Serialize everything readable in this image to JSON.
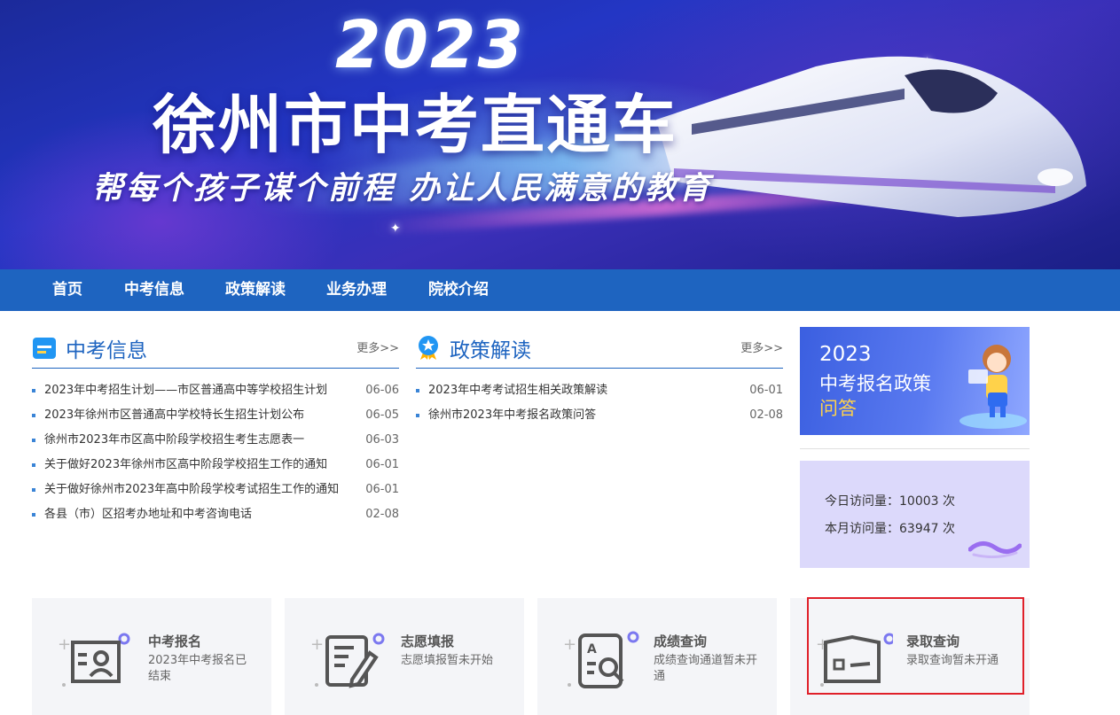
{
  "banner": {
    "year": "2023",
    "title": "徐州市中考直通车",
    "slogan": "帮每个孩子谋个前程  办让人民满意的教育"
  },
  "nav": {
    "items": [
      {
        "label": "首页"
      },
      {
        "label": "中考信息"
      },
      {
        "label": "政策解读"
      },
      {
        "label": "业务办理"
      },
      {
        "label": "院校介绍"
      }
    ]
  },
  "info_section": {
    "title": "中考信息",
    "more": "更多>>",
    "icon": "folder-icon",
    "items": [
      {
        "title": "2023年中考招生计划——市区普通高中等学校招生计划",
        "date": "06-06"
      },
      {
        "title": "2023年徐州市区普通高中学校特长生招生计划公布",
        "date": "06-05"
      },
      {
        "title": "徐州市2023年市区高中阶段学校招生考生志愿表一",
        "date": "06-03"
      },
      {
        "title": "关于做好2023年徐州市区高中阶段学校招生工作的通知",
        "date": "06-01"
      },
      {
        "title": "关于做好徐州市2023年高中阶段学校考试招生工作的通知",
        "date": "06-01"
      },
      {
        "title": "各县（市）区招考办地址和中考咨询电话",
        "date": "02-08"
      }
    ]
  },
  "policy_section": {
    "title": "政策解读",
    "more": "更多>>",
    "icon": "medal-icon",
    "items": [
      {
        "title": "2023年中考考试招生相关政策解读",
        "date": "06-01"
      },
      {
        "title": "徐州市2023年中考报名政策问答",
        "date": "02-08"
      }
    ]
  },
  "promo": {
    "year": "2023",
    "line1": "中考报名政策",
    "line2": "问答"
  },
  "stats": {
    "today": "今日访问量：10003 次",
    "month": "本月访问量：63947 次"
  },
  "services": [
    {
      "title": "中考报名",
      "desc": "2023年中考报名已结束",
      "icon": "id-card-icon"
    },
    {
      "title": "志愿填报",
      "desc": "志愿填报暂未开始",
      "icon": "form-edit-icon"
    },
    {
      "title": "成绩查询",
      "desc": "成绩查询通道暂未开通",
      "icon": "score-search-icon"
    },
    {
      "title": "录取查询",
      "desc": "录取查询暂未开通",
      "icon": "admission-book-icon"
    }
  ],
  "colors": {
    "nav_bg": "#1e64c0",
    "accent": "#1e64c0",
    "promo_highlight": "#ffd24a",
    "stats_bg": "#dcd9fb",
    "card_bg": "#f4f5f8",
    "selection_border": "#e0202a"
  }
}
